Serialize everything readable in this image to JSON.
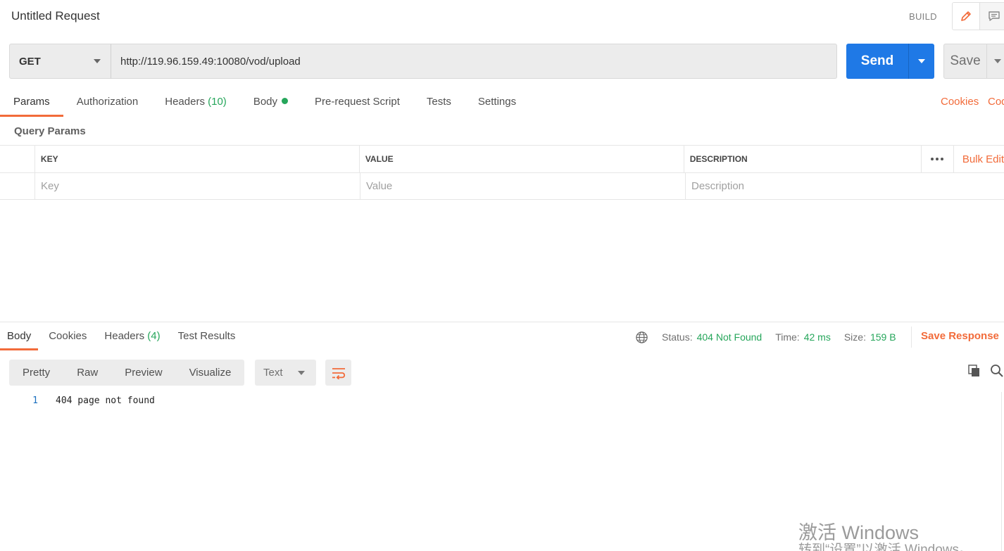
{
  "header": {
    "title": "Untitled Request",
    "build_label": "BUILD",
    "icons": [
      "pencil-icon",
      "comment-icon"
    ]
  },
  "request": {
    "method": "GET",
    "url": "http://119.96.159.49:10080/vod/upload",
    "send_label": "Send",
    "save_label": "Save"
  },
  "request_tabs": [
    {
      "label": "Params",
      "active": true
    },
    {
      "label": "Authorization"
    },
    {
      "label": "Headers ",
      "count": "(10)"
    },
    {
      "label": "Body",
      "indicator": "green-dot"
    },
    {
      "label": "Pre-request Script"
    },
    {
      "label": "Tests"
    },
    {
      "label": "Settings"
    }
  ],
  "links": {
    "cookies": "Cookies",
    "code": "Code"
  },
  "params": {
    "section_label": "Query Params",
    "columns": [
      "KEY",
      "VALUE",
      "DESCRIPTION"
    ],
    "bulk_edit": "Bulk Edit",
    "placeholders": {
      "key": "Key",
      "value": "Value",
      "description": "Description"
    }
  },
  "response_tabs": [
    {
      "label": "Body",
      "active": true
    },
    {
      "label": "Cookies"
    },
    {
      "label": "Headers ",
      "count": "(4)"
    },
    {
      "label": "Test Results"
    }
  ],
  "response_status": {
    "status_label": "Status:",
    "status_value": "404 Not Found",
    "time_label": "Time:",
    "time_value": "42 ms",
    "size_label": "Size:",
    "size_value": "159 B",
    "save_response": "Save Response"
  },
  "view_modes": [
    "Pretty",
    "Raw",
    "Preview",
    "Visualize"
  ],
  "format": "Text",
  "response_body": [
    {
      "line": "1",
      "text": "404 page not found"
    }
  ],
  "watermark": {
    "line1": "激活 Windows",
    "line2": "转到“设置”以激活 Windows。"
  },
  "colors": {
    "accent": "#f26b3a",
    "send": "#1f79e6",
    "success": "#26a65b"
  }
}
